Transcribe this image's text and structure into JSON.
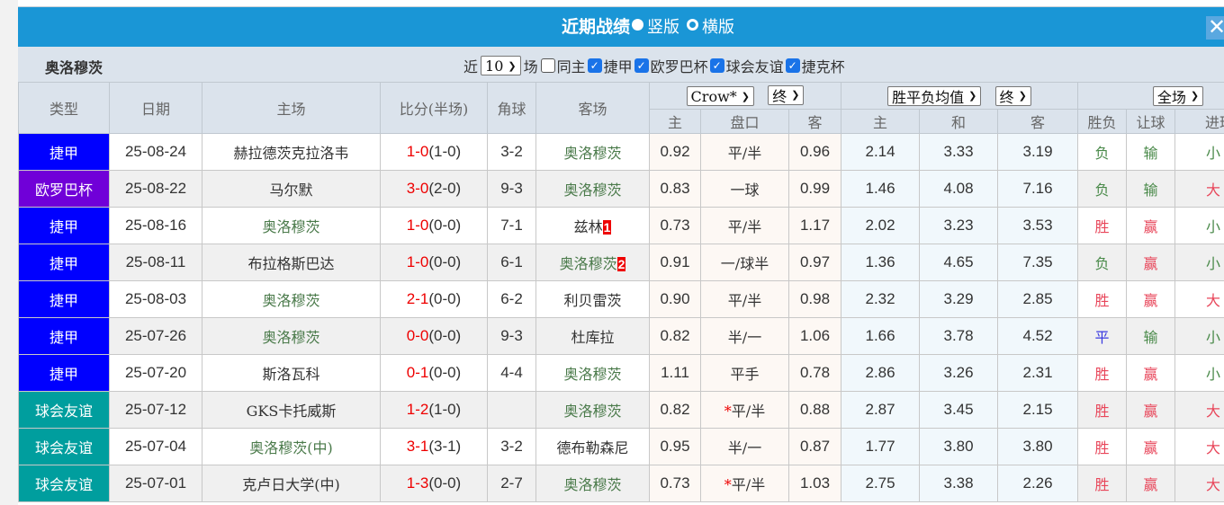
{
  "title": {
    "label": "近期战绩",
    "opt1": "竖版",
    "opt2": "横版",
    "opt1_selected": true,
    "close": "✕"
  },
  "filter": {
    "team": "奥洛穆茨",
    "prefix": "近",
    "count": "10",
    "suffix": "场",
    "checks": [
      {
        "label": "同主",
        "checked": false
      },
      {
        "label": "捷甲",
        "checked": true
      },
      {
        "label": "欧罗巴杯",
        "checked": true
      },
      {
        "label": "球会友谊",
        "checked": true
      },
      {
        "label": "捷克杯",
        "checked": true
      }
    ]
  },
  "headers": {
    "type": "类型",
    "date": "日期",
    "home": "主场",
    "score": "比分(半场)",
    "corner": "角球",
    "away": "客场",
    "company": "Crow*",
    "state1": "终",
    "odds_type": "胜平负均值",
    "state2": "终",
    "period": "全场",
    "sub": [
      "主",
      "盘口",
      "客",
      "主",
      "和",
      "客",
      "胜负",
      "让球",
      "进球数"
    ]
  },
  "colors": {
    "捷甲": "#0000ff",
    "欧罗巴杯": "#7000d8",
    "球会友谊": "#009e9e",
    "title_bg": "#1a96d6",
    "win": "#e8465a",
    "lose": "#4a8a4a",
    "draw": "#3a3ae0"
  },
  "rows": [
    {
      "type": "捷甲",
      "date": "25-08-24",
      "home": "赫拉德茨克拉洛韦",
      "home_team": false,
      "score": "1-0",
      "half": "(1-0)",
      "corner": "3-2",
      "away": "奥洛穆茨",
      "away_team": true,
      "badge": "",
      "h": "0.92",
      "pan": "平/半",
      "star": false,
      "a": "0.96",
      "o1": "2.14",
      "o2": "3.33",
      "o3": "3.19",
      "wl": "负",
      "rq": "输",
      "ou": "小"
    },
    {
      "type": "欧罗巴杯",
      "date": "25-08-22",
      "home": "马尔默",
      "home_team": false,
      "score": "3-0",
      "half": "(2-0)",
      "corner": "9-3",
      "away": "奥洛穆茨",
      "away_team": true,
      "badge": "",
      "h": "0.83",
      "pan": "一球",
      "star": false,
      "a": "0.99",
      "o1": "1.46",
      "o2": "4.08",
      "o3": "7.16",
      "wl": "负",
      "rq": "输",
      "ou": "大"
    },
    {
      "type": "捷甲",
      "date": "25-08-16",
      "home": "奥洛穆茨",
      "home_team": true,
      "score": "1-0",
      "half": "(0-0)",
      "corner": "7-1",
      "away": "兹林",
      "away_team": false,
      "badge": "1",
      "h": "0.73",
      "pan": "平/半",
      "star": false,
      "a": "1.17",
      "o1": "2.02",
      "o2": "3.23",
      "o3": "3.53",
      "wl": "胜",
      "rq": "赢",
      "ou": "小"
    },
    {
      "type": "捷甲",
      "date": "25-08-11",
      "home": "布拉格斯巴达",
      "home_team": false,
      "score": "1-0",
      "half": "(0-0)",
      "corner": "6-1",
      "away": "奥洛穆茨",
      "away_team": true,
      "badge": "2",
      "h": "0.91",
      "pan": "一/球半",
      "star": false,
      "a": "0.97",
      "o1": "1.36",
      "o2": "4.65",
      "o3": "7.35",
      "wl": "负",
      "rq": "赢",
      "ou": "小"
    },
    {
      "type": "捷甲",
      "date": "25-08-03",
      "home": "奥洛穆茨",
      "home_team": true,
      "score": "2-1",
      "half": "(0-0)",
      "corner": "6-2",
      "away": "利贝雷茨",
      "away_team": false,
      "badge": "",
      "h": "0.90",
      "pan": "平/半",
      "star": false,
      "a": "0.98",
      "o1": "2.32",
      "o2": "3.29",
      "o3": "2.85",
      "wl": "胜",
      "rq": "赢",
      "ou": "大"
    },
    {
      "type": "捷甲",
      "date": "25-07-26",
      "home": "奥洛穆茨",
      "home_team": true,
      "score": "0-0",
      "half": "(0-0)",
      "corner": "9-3",
      "away": "杜库拉",
      "away_team": false,
      "badge": "",
      "h": "0.82",
      "pan": "半/一",
      "star": false,
      "a": "1.06",
      "o1": "1.66",
      "o2": "3.78",
      "o3": "4.52",
      "wl": "平",
      "rq": "输",
      "ou": "小"
    },
    {
      "type": "捷甲",
      "date": "25-07-20",
      "home": "斯洛瓦科",
      "home_team": false,
      "score": "0-1",
      "half": "(0-0)",
      "corner": "4-4",
      "away": "奥洛穆茨",
      "away_team": true,
      "badge": "",
      "h": "1.11",
      "pan": "平手",
      "star": false,
      "a": "0.78",
      "o1": "2.86",
      "o2": "3.26",
      "o3": "2.31",
      "wl": "胜",
      "rq": "赢",
      "ou": "小"
    },
    {
      "type": "球会友谊",
      "date": "25-07-12",
      "home": "GKS卡托威斯",
      "home_team": false,
      "score": "1-2",
      "half": "(1-0)",
      "corner": "",
      "away": "奥洛穆茨",
      "away_team": true,
      "badge": "",
      "h": "0.82",
      "pan": "平/半",
      "star": true,
      "a": "0.88",
      "o1": "2.87",
      "o2": "3.45",
      "o3": "2.15",
      "wl": "胜",
      "rq": "赢",
      "ou": "大"
    },
    {
      "type": "球会友谊",
      "date": "25-07-04",
      "home": "奥洛穆茨(中)",
      "home_team": true,
      "score": "3-1",
      "half": "(3-1)",
      "corner": "3-2",
      "away": "德布勒森尼",
      "away_team": false,
      "badge": "",
      "h": "0.95",
      "pan": "半/一",
      "star": false,
      "a": "0.87",
      "o1": "1.77",
      "o2": "3.80",
      "o3": "3.80",
      "wl": "胜",
      "rq": "赢",
      "ou": "大"
    },
    {
      "type": "球会友谊",
      "date": "25-07-01",
      "home": "克卢日大学(中)",
      "home_team": false,
      "score": "1-3",
      "half": "(0-0)",
      "corner": "2-7",
      "away": "奥洛穆茨",
      "away_team": true,
      "badge": "",
      "h": "0.73",
      "pan": "平/半",
      "star": true,
      "a": "1.03",
      "o1": "2.75",
      "o2": "3.38",
      "o3": "2.26",
      "wl": "胜",
      "rq": "赢",
      "ou": "大"
    }
  ]
}
